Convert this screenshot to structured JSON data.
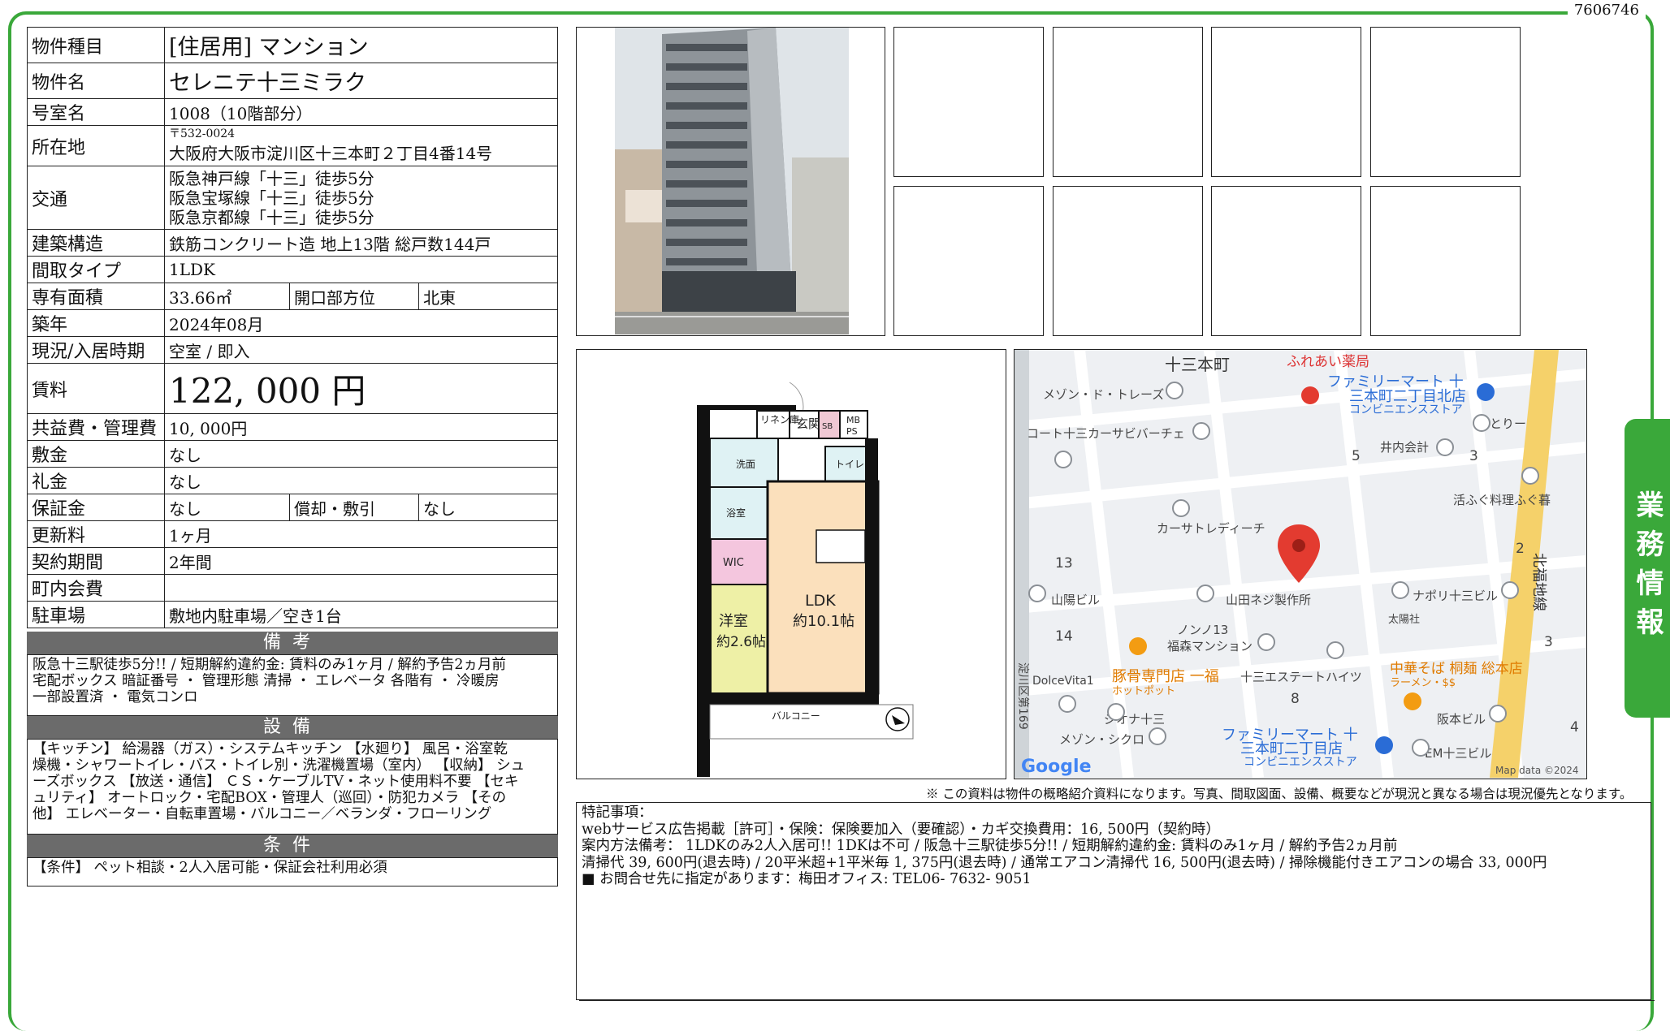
{
  "doc_id": "7606746",
  "side_tab": "業務情報",
  "spec": {
    "type_label": "物件種目",
    "type_value": "[住居用]  マンション",
    "name_label": "物件名",
    "name_value": "セレニテ十三ミラク",
    "room_label": "号室名",
    "room_value": "1008（10階部分）",
    "addr_label": "所在地",
    "postal": "〒532-0024",
    "address": "大阪府大阪市淀川区十三本町２丁目4番14号",
    "access_label": "交通",
    "access": [
      "阪急神戸線「十三」徒歩5分",
      "阪急宝塚線「十三」徒歩5分",
      "阪急京都線「十三」徒歩5分"
    ],
    "structure_label": "建築構造",
    "structure_value": "鉄筋コンクリート造 地上13階 総戸数144戸",
    "layout_label": "間取タイプ",
    "layout_value": "1LDK",
    "area_label": "専有面積",
    "area_value": "33.66㎡",
    "opening_label": "開口部方位",
    "opening_value": "北東",
    "built_label": "築年",
    "built_value": "2024年08月",
    "status_label": "現況/入居時期",
    "status_value": "空室 /  即入",
    "rent_label": "賃料",
    "rent_value": "122, 000 円",
    "fee_label": "共益費・管理費",
    "fee_value": "10, 000円",
    "deposit_label": "敷金",
    "deposit_value": "なし",
    "key_label": "礼金",
    "key_value": "なし",
    "guarantee_label": "保証金",
    "guarantee_value": "なし",
    "amort_label": "償却・敷引",
    "amort_value": "なし",
    "renew_label": "更新料",
    "renew_value": "1ヶ月",
    "term_label": "契約期間",
    "term_value": "2年間",
    "town_label": "町内会費",
    "town_value": "",
    "parking_label": "駐車場",
    "parking_value": "敷地内駐車場／空き1台"
  },
  "remarks": {
    "title": "備考",
    "lines": [
      "阪急十三駅徒歩5分!!  /  短期解約違約金: 賃料のみ1ヶ月  /  解約予告2ヵ月前",
      "宅配ボックス 暗証番号  ・  管理形態 清掃  ・  エレベータ 各階有  ・  冷暖房",
      "一部設置済  ・  電気コンロ"
    ]
  },
  "equipment": {
    "title": "設備",
    "lines": [
      "【キッチン】 給湯器（ガス）・システムキッチン  【水廻り】 風呂・浴室乾",
      "燥機・シャワートイレ・バス・トイレ別・洗濯機置場（室内）  【収納】 シュ",
      "ーズボックス  【放送・通信】  ＣＳ・ケーブルTV・ネット使用料不要  【セキ",
      "ュリティ】  オートロック・宅配BOX・管理人（巡回）・防犯カメラ  【その",
      "他】  エレベーター・自転車置場・バルコニー／ベランダ・フローリング"
    ]
  },
  "conditions": {
    "title": "条件",
    "lines": [
      "【条件】  ペット相談・2人入居可能・保証会社利用必須"
    ]
  },
  "floorplan": {
    "rooms": [
      "リネン庫",
      "玄関",
      "SB",
      "MB",
      "PS",
      "洗面",
      "トイレ",
      "浴室",
      "WIC",
      "LDK",
      "約10.1帖",
      "洋室",
      "約2.6帖",
      "バルコニー"
    ]
  },
  "map": {
    "labels": [
      "十三本町",
      "ふれあい薬局",
      "ファミリーマート 十",
      "三本町二丁目北店",
      "コンビニエンスストア",
      "メゾン・ド・トレーズ",
      "コート十三カーサビバーチェ",
      "とりー",
      "井内会計",
      "活ふぐ料理ふぐ暮",
      "カーサトレディーチ",
      "山田ネジ製作所",
      "山陽ビル",
      "ナポリ十三ビル",
      "太陽社",
      "ノンノ13",
      "福森マンション",
      "豚骨専門店 一福",
      "ホットポット",
      "十三エステートハイツ",
      "中華そば 桐麺 総本店",
      "ラーメン・$$",
      "DolceVita1",
      "ジオナ十三",
      "阪本ビル",
      "メゾン・シクロ",
      "ファミリーマート 十",
      "三本町二丁目店",
      "コンビニエンスストア",
      "EM十三ビル",
      "北福地線",
      "淀川区第169",
      "Map data ©2024"
    ],
    "numbers": [
      "5",
      "3",
      "2",
      "13",
      "14",
      "3",
      "8",
      "4"
    ],
    "logo": "Google"
  },
  "disclaimer": "※  この資料は物件の概略紹介資料になります。写真、間取図面、設備、概要などが現況と異なる場合は現況優先となります。",
  "notes": {
    "title": "特記事項：",
    "lines": [
      "webサービス広告掲載［許可］・保険：保険要加入（要確認）・カギ交換費用：16, 500円（契約時）",
      "案内方法備考：  1LDKのみ2人入居可!! 1DKは不可  /  阪急十三駅徒歩5分!!  /  短期解約違約金: 賃料のみ1ヶ月  /  解約予告2ヵ月前",
      "清掃代  39, 600円(退去時)  /  20平米超+1平米毎  1, 375円(退去時)  /  通常エアコン清掃代  16, 500円(退去時)  /  掃除機能付きエアコンの場合  33, 000円",
      "■  お問合せ先に指定があります：梅田オフィス: TEL06- 7632- 9051"
    ]
  }
}
